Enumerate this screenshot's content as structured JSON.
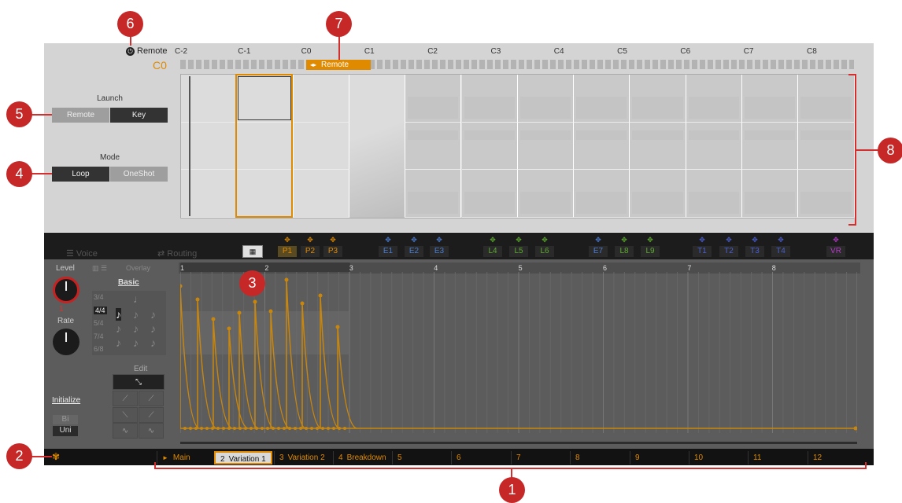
{
  "header": {
    "remote_label": "Remote",
    "root_note": "C0",
    "notes": [
      "C-2",
      "C-1",
      "C0",
      "C1",
      "C2",
      "C3",
      "C4",
      "C5",
      "C6",
      "C7",
      "C8"
    ],
    "remote_tag": "Remote"
  },
  "launch": {
    "title": "Launch",
    "remote": "Remote",
    "key": "Key",
    "selected": "Key"
  },
  "mode": {
    "title": "Mode",
    "loop": "Loop",
    "oneshot": "OneShot",
    "selected": "Loop"
  },
  "tabs": {
    "voice": "Voice",
    "routing": "Routing"
  },
  "slots": [
    {
      "id": "P1",
      "color": "#e08a00",
      "selected": true
    },
    {
      "id": "P2",
      "color": "#e08a00"
    },
    {
      "id": "P3",
      "color": "#e08a00"
    },
    {
      "id": "E1",
      "color": "#4a7bd0"
    },
    {
      "id": "E2",
      "color": "#4a7bd0"
    },
    {
      "id": "E3",
      "color": "#4a7bd0"
    },
    {
      "id": "L4",
      "color": "#5dab2e"
    },
    {
      "id": "L5",
      "color": "#5dab2e"
    },
    {
      "id": "L6",
      "color": "#5dab2e"
    },
    {
      "id": "E7",
      "color": "#4a7bd0"
    },
    {
      "id": "L8",
      "color": "#5dab2e"
    },
    {
      "id": "L9",
      "color": "#5dab2e"
    },
    {
      "id": "T1",
      "color": "#4a5fd0"
    },
    {
      "id": "T2",
      "color": "#4a5fd0"
    },
    {
      "id": "T3",
      "color": "#4a5fd0"
    },
    {
      "id": "T4",
      "color": "#4a5fd0"
    },
    {
      "id": "VR",
      "color": "#b43ac7"
    }
  ],
  "editor": {
    "overlay_label": "Overlay",
    "basic_label": "Basic",
    "level_label": "Level",
    "level_value": "1",
    "rate_label": "Rate",
    "edit_label": "Edit",
    "initialize_label": "Initialize",
    "bi_label": "Bi",
    "uni_label": "Uni",
    "time_sigs": [
      "3/4",
      "4/4",
      "5/4",
      "7/4",
      "6/8"
    ],
    "bar_numbers": [
      "1",
      "2",
      "3",
      "4",
      "5",
      "6",
      "7",
      "8"
    ],
    "envelope_color": "#c8860d"
  },
  "scenes": [
    {
      "num": "",
      "name": "Main",
      "play": true
    },
    {
      "num": "2",
      "name": "Variation 1",
      "selected": true
    },
    {
      "num": "3",
      "name": "Variation 2"
    },
    {
      "num": "4",
      "name": "Breakdown"
    },
    {
      "num": "5",
      "name": ""
    },
    {
      "num": "6",
      "name": ""
    },
    {
      "num": "7",
      "name": ""
    },
    {
      "num": "8",
      "name": ""
    },
    {
      "num": "9",
      "name": ""
    },
    {
      "num": "10",
      "name": ""
    },
    {
      "num": "11",
      "name": ""
    },
    {
      "num": "12",
      "name": ""
    }
  ],
  "callouts": [
    "1",
    "2",
    "3",
    "4",
    "5",
    "6",
    "7",
    "8"
  ]
}
